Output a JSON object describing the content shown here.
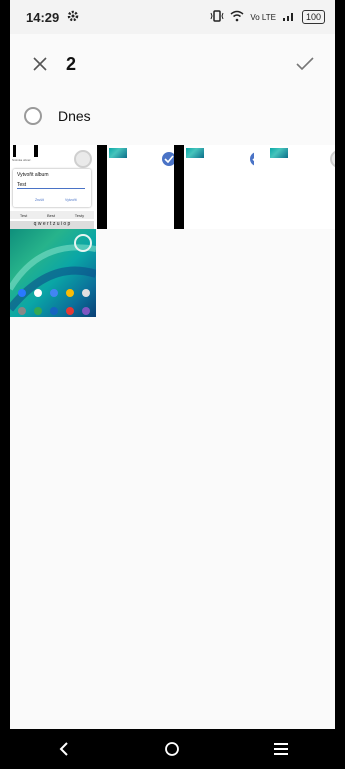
{
  "status": {
    "time": "14:29",
    "lte": "Vo LTE",
    "battery": "100"
  },
  "topbar": {
    "count": "2"
  },
  "section": {
    "date_label": "Dnes"
  },
  "dialog": {
    "title": "Vytvořit album",
    "input_value": "Test",
    "cancel": "Zrušit",
    "create": "Vytvořit",
    "suggestions": [
      "Test",
      "Best",
      "Testy"
    ],
    "keyboard_row": "q w e r t z u i o p"
  },
  "tile_label": "Snímka obraz."
}
